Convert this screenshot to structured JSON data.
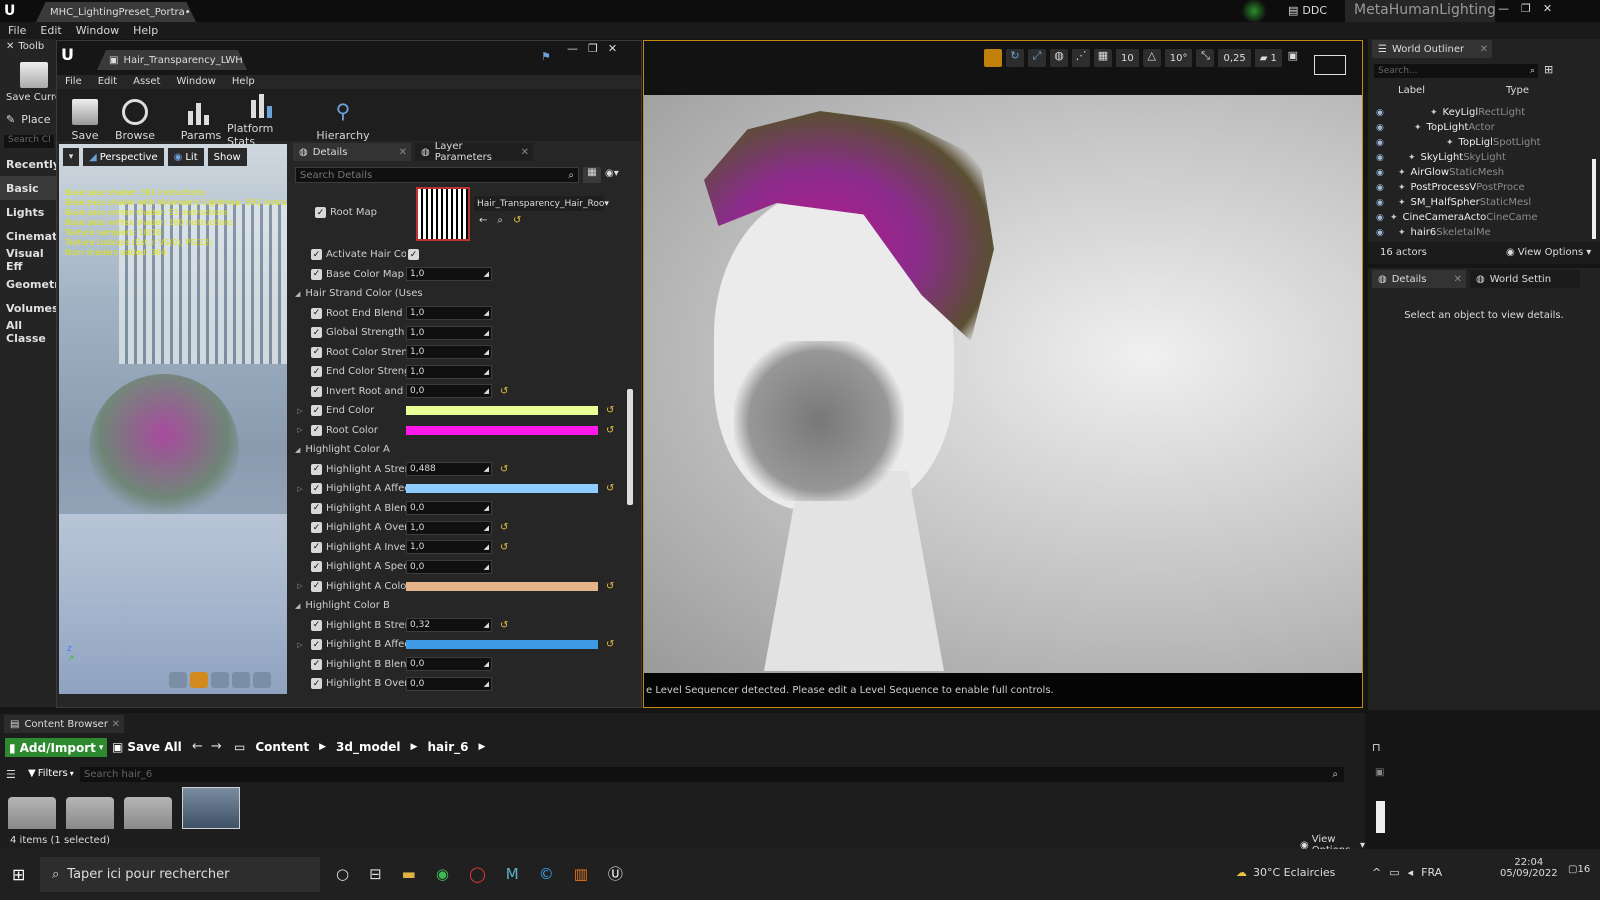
{
  "titlebar": {
    "tab": "MHC_LightingPreset_Portra•",
    "ddc": "DDC",
    "project": "MetaHumanLighting"
  },
  "main_menu": [
    "File",
    "Edit",
    "Window",
    "Help"
  ],
  "left_panel": {
    "toolbar_title": "Toolb",
    "save_label": "Save Curre",
    "place_title": "Place",
    "search_placeholder": "Search Cl",
    "categories": [
      "Recently",
      "Basic",
      "Lights",
      "Cinematic",
      "Visual Eff",
      "Geometry",
      "Volumes",
      "All Classe"
    ]
  },
  "material_editor": {
    "tab": "Hair_Transparency_LWH•",
    "menu": [
      "File",
      "Edit",
      "Asset",
      "Window",
      "Help"
    ],
    "toolbar": [
      "Save",
      "Browse",
      "Params",
      "Platform Stats",
      "Hierarchy"
    ],
    "viewport_buttons": {
      "perspective": "Perspective",
      "lit": "Lit",
      "show": "Show"
    },
    "stats": [
      "Base pass shader: 391 instructions",
      "Base pass shader with Volumetric Lightmap: 581 instru",
      "Base pass vertex shader: 51 instructions",
      "Base pass vertex shader: 160 instructions",
      "Texture samplers: 10/16",
      "Texture Lookups (Est.): VS(0), PS(12)",
      "Num shaders added: 364"
    ],
    "tabs": {
      "details": "Details",
      "layer": "Layer Parameters"
    },
    "search_placeholder": "Search Details",
    "root_map": {
      "label": "Root Map",
      "asset": "Hair_Transparency_Hair_Roo"
    },
    "rows": [
      {
        "type": "check",
        "label": "Activate Hair Color"
      },
      {
        "type": "num",
        "label": "Base Color Map Str",
        "value": "1,0"
      },
      {
        "type": "cat",
        "label": "Hair Strand Color (Uses"
      },
      {
        "type": "num",
        "label": "Root End Blend Mod",
        "value": "1,0"
      },
      {
        "type": "num",
        "label": "Global Strength",
        "value": "1,0"
      },
      {
        "type": "num",
        "label": "Root Color Strength",
        "value": "1,0"
      },
      {
        "type": "num",
        "label": "End Color Strength",
        "value": "1,0"
      },
      {
        "type": "num",
        "label": "Invert Root and End",
        "value": "0,0",
        "reset": true
      },
      {
        "type": "color",
        "label": "End Color",
        "color": "#eaff96",
        "reset": true
      },
      {
        "type": "color",
        "label": "Root Color",
        "color": "#ff16e8",
        "reset": true
      },
      {
        "type": "cat",
        "label": "Highlight Color A"
      },
      {
        "type": "num",
        "label": "Highlight A Strength",
        "value": "0,488",
        "reset": true
      },
      {
        "type": "color",
        "label": "Highlight A Affected",
        "color": "#8ecbff",
        "reset": true
      },
      {
        "type": "num",
        "label": "Highlight A Blend M",
        "value": "0,0"
      },
      {
        "type": "num",
        "label": "Highlight A Overlap",
        "value": "1,0",
        "reset": true
      },
      {
        "type": "num",
        "label": "Highlight A Invert E",
        "value": "1,0",
        "reset": true
      },
      {
        "type": "num",
        "label": "Highlight A Specula",
        "value": "0,0"
      },
      {
        "type": "color",
        "label": "Highlight A Color",
        "color": "#e5b48b",
        "reset": true
      },
      {
        "type": "cat",
        "label": "Highlight Color B"
      },
      {
        "type": "num",
        "label": "Highlight B Strength",
        "value": "0,32",
        "reset": true
      },
      {
        "type": "color",
        "label": "Highlight B Affected",
        "color": "#3f9ae5",
        "reset": true
      },
      {
        "type": "num",
        "label": "Highlight B Blend M",
        "value": "0,0"
      },
      {
        "type": "num",
        "label": "Highlight B Overlap",
        "value": "0,0"
      }
    ]
  },
  "viewport": {
    "toolbar_values": [
      "10",
      "10°",
      "0,25",
      "1"
    ],
    "status": "e Level Sequencer detected. Please edit a Level Sequence to enable full controls."
  },
  "outliner": {
    "title": "World Outliner",
    "search_placeholder": "Search...",
    "col_label": "Label",
    "col_type": "Type",
    "rows": [
      {
        "name": "KeyLigl",
        "type": "RectLight"
      },
      {
        "name": "TopLight",
        "type": "Actor"
      },
      {
        "name": "TopLigl",
        "type": "SpotLight"
      },
      {
        "name": "SkyLight",
        "type": "SkyLight"
      },
      {
        "name": "AirGlow",
        "type": "StaticMesh"
      },
      {
        "name": "PostProcessV",
        "type": "PostProce"
      },
      {
        "name": "SM_HalfSpher",
        "type": "StaticMesl"
      },
      {
        "name": "CineCameraActo",
        "type": "CineCame"
      },
      {
        "name": "hair6",
        "type": "SkeletalMe"
      }
    ],
    "count": "16 actors",
    "view_options": "View Options"
  },
  "details_panel": {
    "tab1": "Details",
    "tab2": "World Settin",
    "message": "Select an object to view details."
  },
  "content_browser": {
    "title": "Content Browser",
    "add": "Add/Import",
    "save_all": "Save All",
    "path": [
      "Content",
      "3d_model",
      "hair_6"
    ],
    "filters": "Filters",
    "search_placeholder": "Search hair_6",
    "status": "4 items (1 selected)",
    "view_options": "View Options"
  },
  "taskbar": {
    "search": "Taper ici pour rechercher",
    "weather": "30°C  Eclaircies",
    "lang": "FRA",
    "time": "22:04",
    "date": "05/09/2022",
    "notif": "16"
  }
}
